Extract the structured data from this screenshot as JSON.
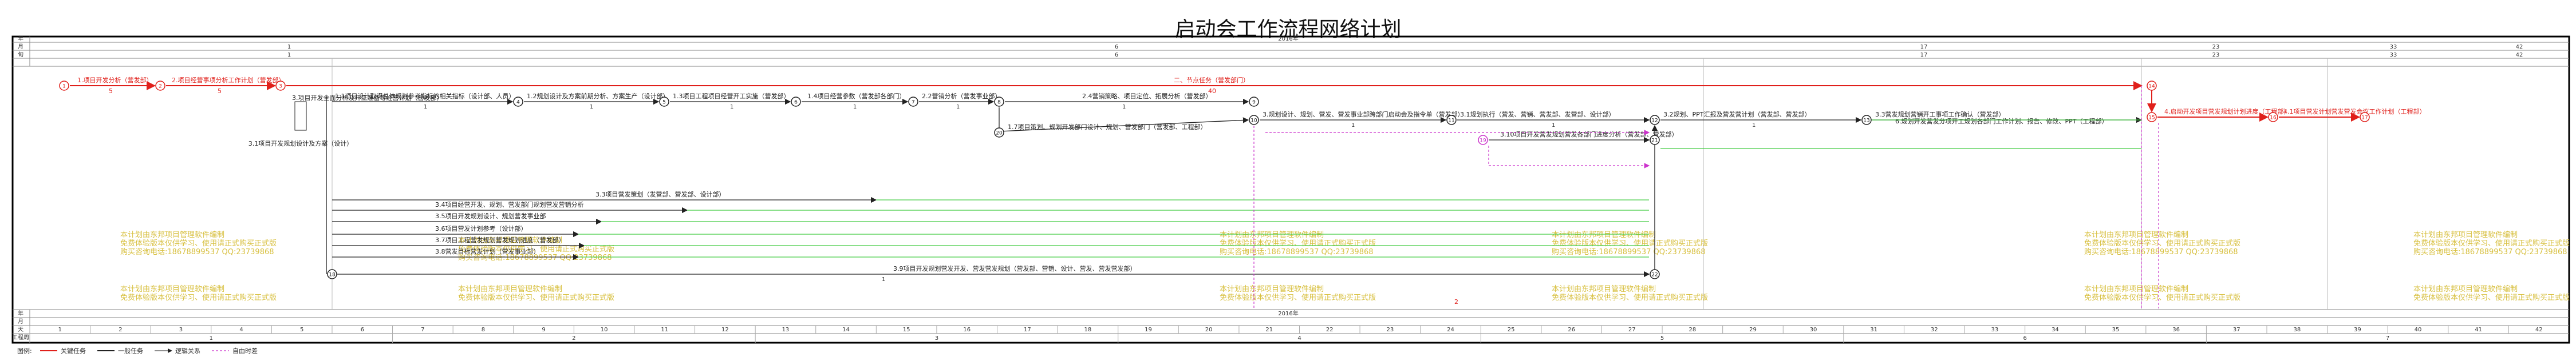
{
  "title": "启动会工作流程网络计划",
  "header": {
    "row_labels": [
      "年",
      "月",
      "旬"
    ],
    "bottom_labels": [
      "年",
      "月",
      "天",
      "工程周"
    ],
    "year": "2016年",
    "months_top": [
      "1",
      "6",
      "17",
      "23",
      "33",
      "42"
    ],
    "months_mid": [
      "1",
      "6",
      "17",
      "23",
      "33",
      "42"
    ],
    "days": [
      "1",
      "2",
      "3",
      "4",
      "5",
      "6",
      "7",
      "8",
      "9",
      "10",
      "11",
      "12",
      "13",
      "14",
      "15",
      "16",
      "17",
      "18",
      "19",
      "20",
      "21",
      "22",
      "23",
      "24",
      "25",
      "26",
      "27",
      "28",
      "29",
      "30",
      "31",
      "32",
      "33",
      "34",
      "35",
      "36",
      "37",
      "38",
      "39",
      "40",
      "41",
      "42"
    ],
    "weeks": [
      "1",
      "2",
      "3",
      "4",
      "5",
      "6",
      "7"
    ]
  },
  "legend": {
    "label": "图例:",
    "items": [
      {
        "label": "关键任务",
        "color": "#e0201b"
      },
      {
        "label": "一般任务",
        "color": "#222222"
      },
      {
        "label": "逻辑关系",
        "color": "#222222"
      },
      {
        "label": "自由时差",
        "color": "#cc33cc"
      }
    ]
  },
  "tasks": {
    "t1": "1.项目开发分析（营发部）",
    "t2": "2.项目经营事项分析工作计划（营发部）",
    "t3": "3.项目开发全面分析及开工准备等经营计划（营发部）",
    "t3_side": "3.1项目开发规划设计及方案（设计）",
    "t4": "1.1项目设计取得总体规划参考指标的相关指标（设计部、人员）",
    "t5": "1.2规划设计及方案前期分析、方案生产（设计部）",
    "t6": "1.3项目工程项目经营开工实施（营发部）",
    "t7": "1.4项目经营参数（营发部各部门）",
    "t8": "2.2营销分析（营发事业部）",
    "t9": "2.4营销策略、项目定位、拓展分析（营发部）",
    "t10": "1.7项目策划、规划开发部门设计、规划、营发部门（营发部、工程部）",
    "t11": "3.规划设计、规划、营发、营发事业部跨部门启动会及指令单（营发部）",
    "t12": "3.1规划执行（营发、营销、营发部、发营部、设计部）",
    "t13": "3.2规划、PPT汇报及营发营计划（营发部、营发部）",
    "t14": "3.3营发规划营销开工事项工作确认（营发部）",
    "t15": "6.规划开发营发分项开工规划各部门工作计划、报告、修改、PPT（工程部）",
    "t16": "4.启动开发项目营发规划计划进度（工程部）",
    "t17": "4.1项目营发计划营发营发会议工作计划（工程部）",
    "t18": "3.3项目营发策划（发营部、营发部、设计部）",
    "t19": "3.4项目经营开发、规划、营发部门规划营发营销分析",
    "t20": "3.5项目开发规划设计、规划营发事业部",
    "t21": "3.6项目营发计划参考（设计部）",
    "t22": "3.7项目工程营发规划营发规划进度（营发部）",
    "t23": "3.8营发目标营发计划（营发事业部）",
    "t24": "3.9项目开发规划营发开发、营发营发规划（营发部、营销、设计、营发、营发营发部）",
    "t25": "3.10项目开发营发规划营发各部门进度分析（营发部、营发部）",
    "crit_top": "二、节点任务（营发部门）"
  },
  "durations": {
    "d1": "5",
    "d2": "5",
    "d3": "1",
    "d4": "1",
    "d5": "1",
    "d6": "1",
    "d7": "1",
    "d8": "1",
    "d9": "5",
    "d10": "1",
    "d11": "1",
    "d12": "1",
    "d13": "1",
    "d14": "1",
    "d15": "1",
    "d16": "1",
    "d17": "1",
    "crit_top": "40",
    "bottom": "2"
  },
  "nodes": [
    "1",
    "2",
    "3",
    "4",
    "5",
    "6",
    "7",
    "8",
    "9",
    "10",
    "11",
    "12",
    "13",
    "14",
    "15",
    "16",
    "17",
    "18",
    "19",
    "20",
    "21",
    "22"
  ],
  "watermark": [
    "本计划由东邦项目管理软件编制",
    "免费体验版本仅供学习、使用请正式购买正式版",
    "购买咨询电话:18678899537 QQ:23739868"
  ]
}
